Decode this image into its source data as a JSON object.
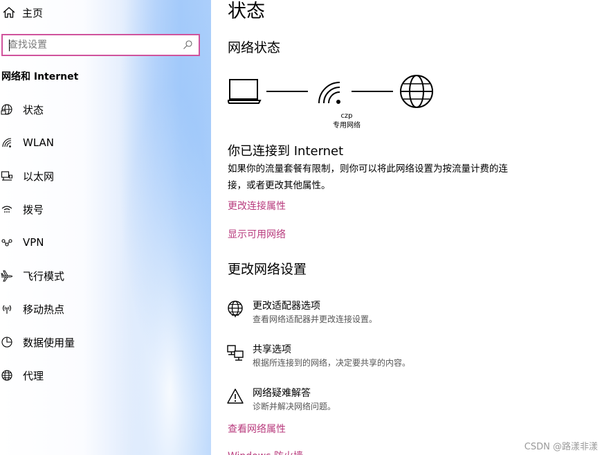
{
  "sidebar": {
    "home_label": "主页",
    "search_placeholder": "查找设置",
    "section_title": "网络和 Internet",
    "items": [
      {
        "label": "状态",
        "icon": "globe-status-icon"
      },
      {
        "label": "WLAN",
        "icon": "wifi-icon"
      },
      {
        "label": "以太网",
        "icon": "ethernet-icon"
      },
      {
        "label": "拨号",
        "icon": "dialup-icon"
      },
      {
        "label": "VPN",
        "icon": "vpn-icon"
      },
      {
        "label": "飞行模式",
        "icon": "airplane-icon"
      },
      {
        "label": "移动热点",
        "icon": "hotspot-icon"
      },
      {
        "label": "数据使用量",
        "icon": "data-usage-icon"
      },
      {
        "label": "代理",
        "icon": "globe-icon"
      }
    ]
  },
  "main": {
    "title": "状态",
    "network_status_heading": "网络状态",
    "network": {
      "name": "czp",
      "type": "专用网络"
    },
    "connected_heading": "你已连接到 Internet",
    "connected_desc": "如果你的流量套餐有限制，则你可以将此网络设置为按流量计费的连接，或者更改其他属性。",
    "links": {
      "change_connection_properties": "更改连接属性",
      "show_available_networks": "显示可用网络",
      "view_network_properties": "查看网络属性",
      "windows_firewall": "Windows 防火墙"
    },
    "change_settings_heading": "更改网络设置",
    "options": [
      {
        "title": "更改适配器选项",
        "desc": "查看网络适配器并更改连接设置。",
        "icon": "adapter-globe-icon"
      },
      {
        "title": "共享选项",
        "desc": "根据所连接到的网络，决定要共享的内容。",
        "icon": "sharing-icon"
      },
      {
        "title": "网络疑难解答",
        "desc": "诊断并解决网络问题。",
        "icon": "warning-icon"
      }
    ]
  },
  "watermark": "CSDN @路漾非漾",
  "colors": {
    "accent": "#b83b7d",
    "search_border": "#d0539c"
  }
}
